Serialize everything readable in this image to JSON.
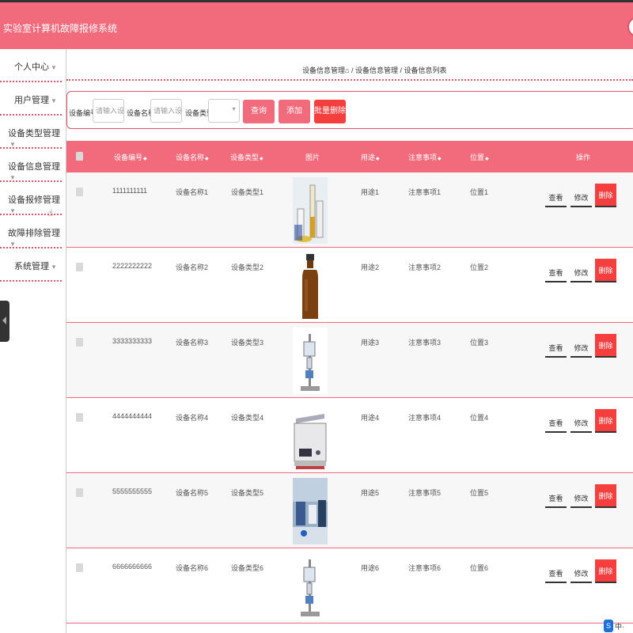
{
  "header": {
    "title": "实验室计算机故障报修系统"
  },
  "sidebar": {
    "items": [
      {
        "label": "个人中心"
      },
      {
        "label": "用户管理"
      },
      {
        "label": "设备类型管理"
      },
      {
        "label": "设备信息管理"
      },
      {
        "label": "设备报修管理"
      },
      {
        "label": "故障排除管理"
      },
      {
        "label": "系统管理"
      }
    ]
  },
  "breadcrumb": {
    "section": "设备信息管理",
    "path": "/ 设备信息管理 / 设备信息列表"
  },
  "search": {
    "code_label": "设备编号",
    "code_placeholder": "请输入设备",
    "name_label": "设备名称",
    "name_placeholder": "请输入设备",
    "type_label": "设备类型",
    "query_button": "查询",
    "add_button": "添加",
    "batch_delete_button": "批量删除"
  },
  "table": {
    "headers": [
      "设备编号",
      "设备名称",
      "设备类型",
      "图片",
      "用途",
      "注意事项",
      "位置",
      "操作"
    ],
    "action_labels": {
      "view": "查看",
      "edit": "修改",
      "delete": "删除"
    },
    "rows": [
      {
        "code": "1111111111",
        "name": "设备名称1",
        "type": "设备类型1",
        "use": "用途1",
        "notes": "注意事项1",
        "location": "位置1",
        "image": "lab-glassware"
      },
      {
        "code": "2222222222",
        "name": "设备名称2",
        "type": "设备类型2",
        "use": "用途2",
        "notes": "注意事项2",
        "location": "位置2",
        "image": "brown-bottle"
      },
      {
        "code": "3333333333",
        "name": "设备名称3",
        "type": "设备类型3",
        "use": "用途3",
        "notes": "注意事项3",
        "location": "位置3",
        "image": "stand-apparatus"
      },
      {
        "code": "4444444444",
        "name": "设备名称4",
        "type": "设备类型4",
        "use": "用途4",
        "notes": "注意事项4",
        "location": "位置4",
        "image": "ultrasonic-cleaner"
      },
      {
        "code": "5555555555",
        "name": "设备名称5",
        "type": "设备类型5",
        "use": "用途5",
        "notes": "注意事项5",
        "location": "位置5",
        "image": "lab-room"
      },
      {
        "code": "6666666666",
        "name": "设备名称6",
        "type": "设备类型6",
        "use": "用途6",
        "notes": "注意事项6",
        "location": "位置6",
        "image": "stand-apparatus"
      }
    ]
  },
  "badge": {
    "icon": "S",
    "text": "中·"
  },
  "colors": {
    "primary": "#f26b7c",
    "danger": "#f53f3f"
  }
}
